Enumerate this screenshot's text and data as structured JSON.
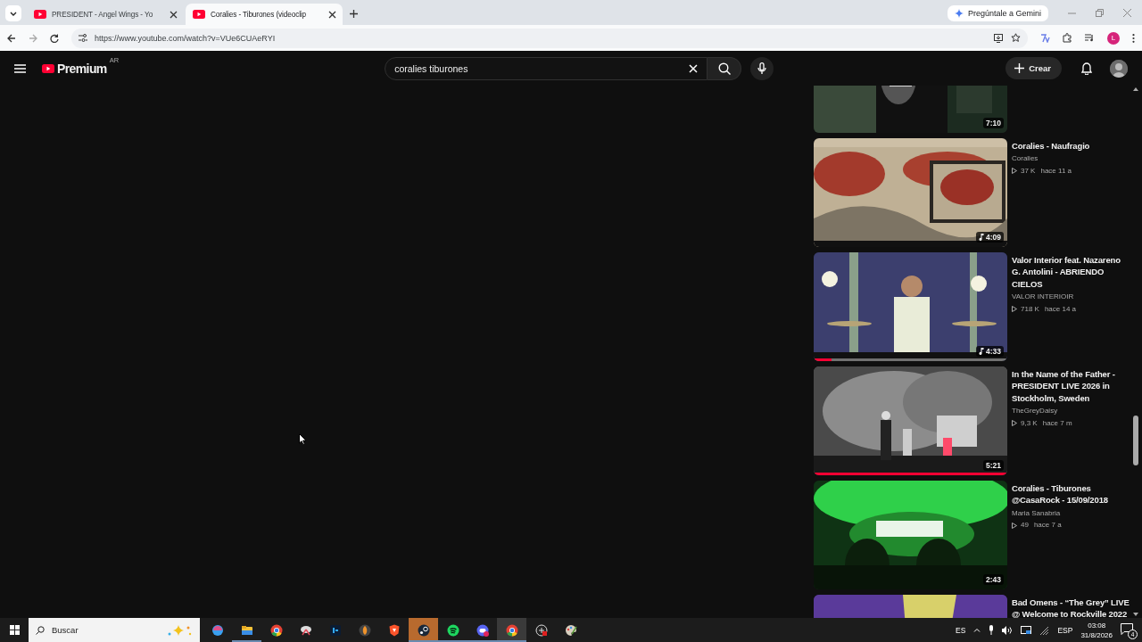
{
  "browser": {
    "tabs": [
      {
        "title": "PRESIDENT - Angel Wings - Yo",
        "selected": false
      },
      {
        "title": "Coralies - Tiburones (videoclip",
        "selected": true
      }
    ],
    "gemini_button": "Pregúntale a Gemini",
    "url": "https://www.youtube.com/watch?v=VUe6CUAeRYI",
    "profile_initial": "L"
  },
  "header": {
    "logo_text": "Premium",
    "country": "AR",
    "search": {
      "value": "coralies tiburones"
    },
    "create_button": "Crear"
  },
  "videos": [
    {
      "kind": "cut",
      "duration": "7:10",
      "music": false
    },
    {
      "kind": "full",
      "title": "Coralies - Naufragio",
      "channel": "Coralies",
      "views": "37 K",
      "age": "hace 11 a",
      "duration": "4:09",
      "music": true
    },
    {
      "kind": "full",
      "title": "Valor Interior feat. Nazareno G. Antolini - ABRIENDO CIELOS",
      "channel": "VALOR INTERIOIR",
      "views": "718 K",
      "age": "hace 14 a",
      "duration": "4:33",
      "music": true,
      "level": 0.09
    },
    {
      "kind": "full",
      "title": "In the Name of the Father - PRESIDENT LIVE 2026 in Stockholm, Sweden",
      "channel": "TheGreyDaisy",
      "views": "9,3 K",
      "age": "hace 7 m",
      "duration": "5:21",
      "music": false,
      "level": 1
    },
    {
      "kind": "full",
      "title": "Coralies - Tiburones @CasaRock - 15/09/2018",
      "channel": "Maria Sanabria",
      "views": "49",
      "age": "hace 7 a",
      "duration": "2:43",
      "music": false
    },
    {
      "kind": "full",
      "title": "Bad Omens - “The Grey” LIVE @ Welcome to Rockville 2022"
    }
  ],
  "taskbar": {
    "search": {
      "placeholder": "Buscar"
    },
    "apps": [
      {
        "running": false,
        "selected": false,
        "hovered": false
      },
      {
        "running": true,
        "selected": false,
        "hovered": false
      },
      {
        "running": false,
        "selected": false,
        "hovered": false
      },
      {
        "running": false,
        "selected": false,
        "hovered": false
      },
      {
        "running": false,
        "selected": false,
        "hovered": false
      },
      {
        "running": false,
        "selected": false,
        "hovered": false
      },
      {
        "running": false,
        "selected": false,
        "hovered": false
      },
      {
        "running": true,
        "selected": false,
        "hovered": true
      },
      {
        "running": true,
        "selected": false,
        "hovered": false
      },
      {
        "running": true,
        "selected": false,
        "hovered": false
      },
      {
        "running": true,
        "selected": true,
        "hovered": false
      },
      {
        "running": false,
        "selected": false,
        "hovered": false
      },
      {
        "running": false,
        "selected": false,
        "hovered": false
      }
    ],
    "tray": {
      "input_language": "ES",
      "keyboard": "ESP",
      "time": "03:08",
      "date": "31/8/2026",
      "notifications": "4"
    }
  }
}
